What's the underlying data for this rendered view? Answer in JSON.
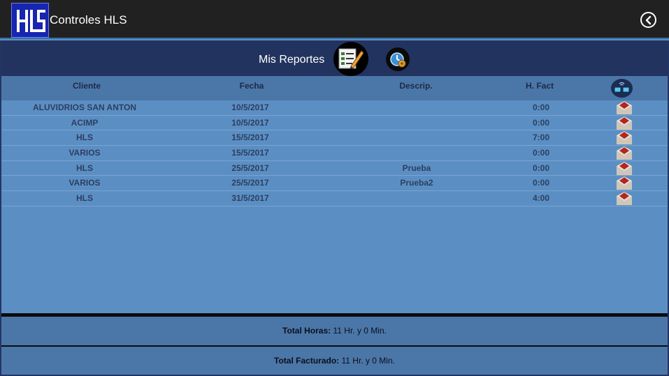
{
  "app": {
    "title": "Controles HLS",
    "logo_text": "HLS"
  },
  "header": {
    "section_title": "Mis Reportes"
  },
  "table": {
    "columns": {
      "cliente": "Cliente",
      "fecha": "Fecha",
      "descrip": "Descrip.",
      "hfact": "H. Fact"
    },
    "rows": [
      {
        "cliente": "ALUVIDRIOS SAN ANTON",
        "fecha": "10/5/2017",
        "descrip": "",
        "hfact": "0:00"
      },
      {
        "cliente": "ACIMP",
        "fecha": "10/5/2017",
        "descrip": "",
        "hfact": "0:00"
      },
      {
        "cliente": "HLS",
        "fecha": "15/5/2017",
        "descrip": "",
        "hfact": "7:00"
      },
      {
        "cliente": "VARIOS",
        "fecha": "15/5/2017",
        "descrip": "",
        "hfact": "0:00"
      },
      {
        "cliente": "HLS",
        "fecha": "25/5/2017",
        "descrip": "Prueba",
        "hfact": "0:00"
      },
      {
        "cliente": "VARIOS",
        "fecha": "25/5/2017",
        "descrip": "Prueba2",
        "hfact": "0:00"
      },
      {
        "cliente": "HLS",
        "fecha": "31/5/2017",
        "descrip": "",
        "hfact": "4:00"
      }
    ]
  },
  "totals": {
    "horas_label": "Total Horas:",
    "horas_value": " 11 Hr. y 0 Min.",
    "facturado_label": "Total Facturado:",
    "facturado_value": " 11 Hr. y 0 Min."
  },
  "icons": {
    "logo": "hls-logo",
    "back": "back-chevron-circle-icon",
    "report": "report-edit-icon",
    "clock": "clock-settings-icon",
    "sync": "sync-devices-icon",
    "row_action": "envelope-icon"
  },
  "colors": {
    "appbar": "#212121",
    "header_band": "#23335f",
    "body": "#5b8fc4",
    "column_header": "#4b76a8"
  }
}
